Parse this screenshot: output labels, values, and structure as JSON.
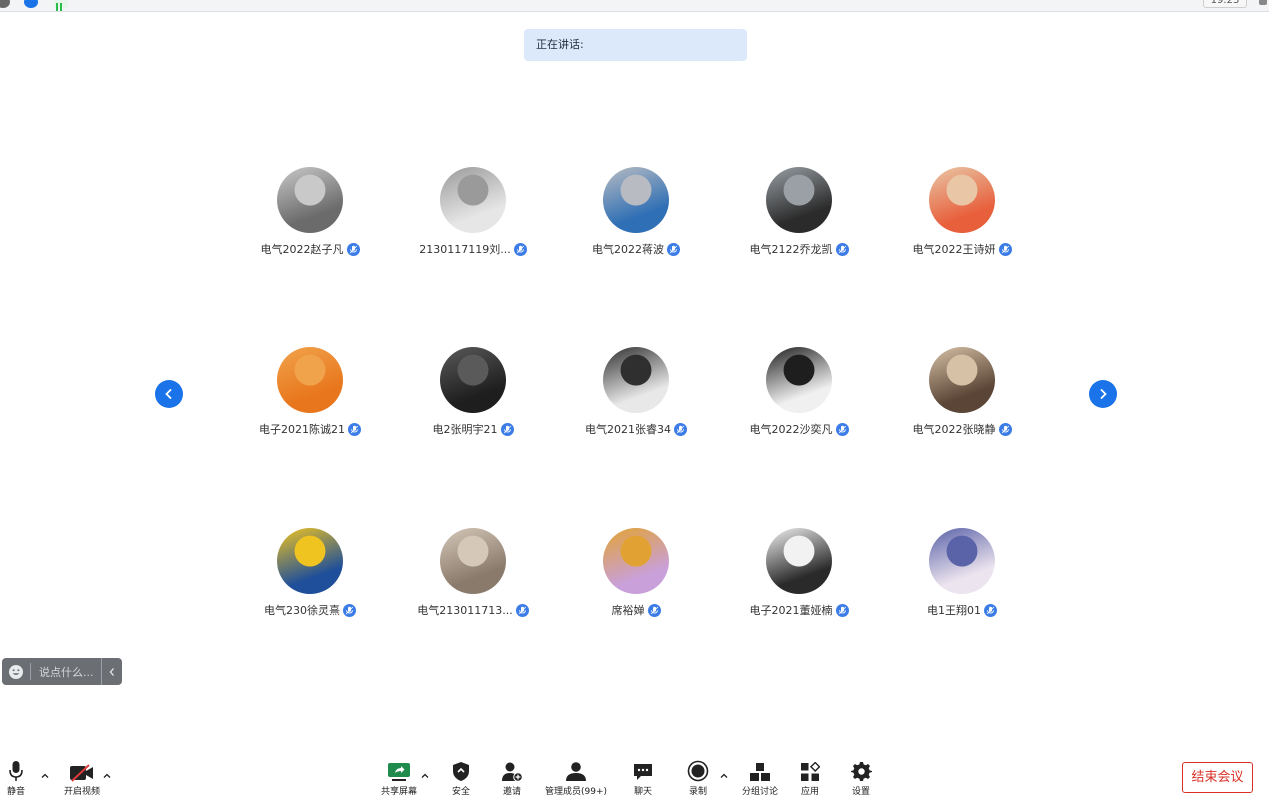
{
  "topbar": {
    "clock": "19:23"
  },
  "speaking_label": "正在讲话:",
  "participants": [
    {
      "name": "电气2022赵子凡",
      "avatar": "avatar-photo-icon",
      "colors": [
        "#6b6b6b",
        "#c9c9c9"
      ]
    },
    {
      "name": "2130117119刘...",
      "avatar": "avatar-sketch-icon",
      "colors": [
        "#e6e6e6",
        "#9a9a9a"
      ]
    },
    {
      "name": "电气2022蒋波",
      "avatar": "avatar-photo-icon",
      "colors": [
        "#2f6fb5",
        "#b8bcc2"
      ]
    },
    {
      "name": "电气2122乔龙凯",
      "avatar": "avatar-photo-icon",
      "colors": [
        "#2b2b2b",
        "#9aa0a6"
      ]
    },
    {
      "name": "电气2022王诗妍",
      "avatar": "avatar-photo-icon",
      "colors": [
        "#e85f3c",
        "#e9c7a6"
      ]
    },
    {
      "name": "电子2021陈诚21",
      "avatar": "avatar-cat-icon",
      "colors": [
        "#e8761c",
        "#f1a34c"
      ]
    },
    {
      "name": "电2张明宇21",
      "avatar": "avatar-photo-icon",
      "colors": [
        "#1e1e1e",
        "#5a5a5a"
      ]
    },
    {
      "name": "电气2021张睿34",
      "avatar": "avatar-cartoon-icon",
      "colors": [
        "#e8e8e8",
        "#2f2f2f"
      ]
    },
    {
      "name": "电气2022沙奕凡",
      "avatar": "avatar-photo-icon",
      "colors": [
        "#f0f0f0",
        "#1e1e1e"
      ]
    },
    {
      "name": "电气2022张晓静",
      "avatar": "avatar-photo-icon",
      "colors": [
        "#5a4536",
        "#d7c1a6"
      ]
    },
    {
      "name": "电气230徐灵熹",
      "avatar": "avatar-anime-icon",
      "colors": [
        "#1f4f9a",
        "#f0c420"
      ]
    },
    {
      "name": "电气213011713...",
      "avatar": "avatar-photo-icon",
      "colors": [
        "#8a7a6c",
        "#d5c8b9"
      ]
    },
    {
      "name": "席裕婵",
      "avatar": "avatar-cartoon-icon",
      "colors": [
        "#c9a0d9",
        "#e2a233"
      ]
    },
    {
      "name": "电子2021董娅楠",
      "avatar": "avatar-cat-icon",
      "colors": [
        "#2a2a2a",
        "#f2f2f2"
      ]
    },
    {
      "name": "电1王翔01",
      "avatar": "avatar-toy-icon",
      "colors": [
        "#ece4ee",
        "#5a62a8"
      ]
    }
  ],
  "chat": {
    "placeholder": "说点什么..."
  },
  "toolbar": {
    "mute": "静音",
    "video": "开启视频",
    "share": "共享屏幕",
    "security": "安全",
    "invite": "邀请",
    "members": "管理成员(99+)",
    "chat": "聊天",
    "record": "录制",
    "breakout": "分组讨论",
    "apps": "应用",
    "settings": "设置",
    "end": "结束会议"
  },
  "colors": {
    "accent": "#1a73e8",
    "end": "#d93025",
    "badge": "#3c7ce6"
  }
}
